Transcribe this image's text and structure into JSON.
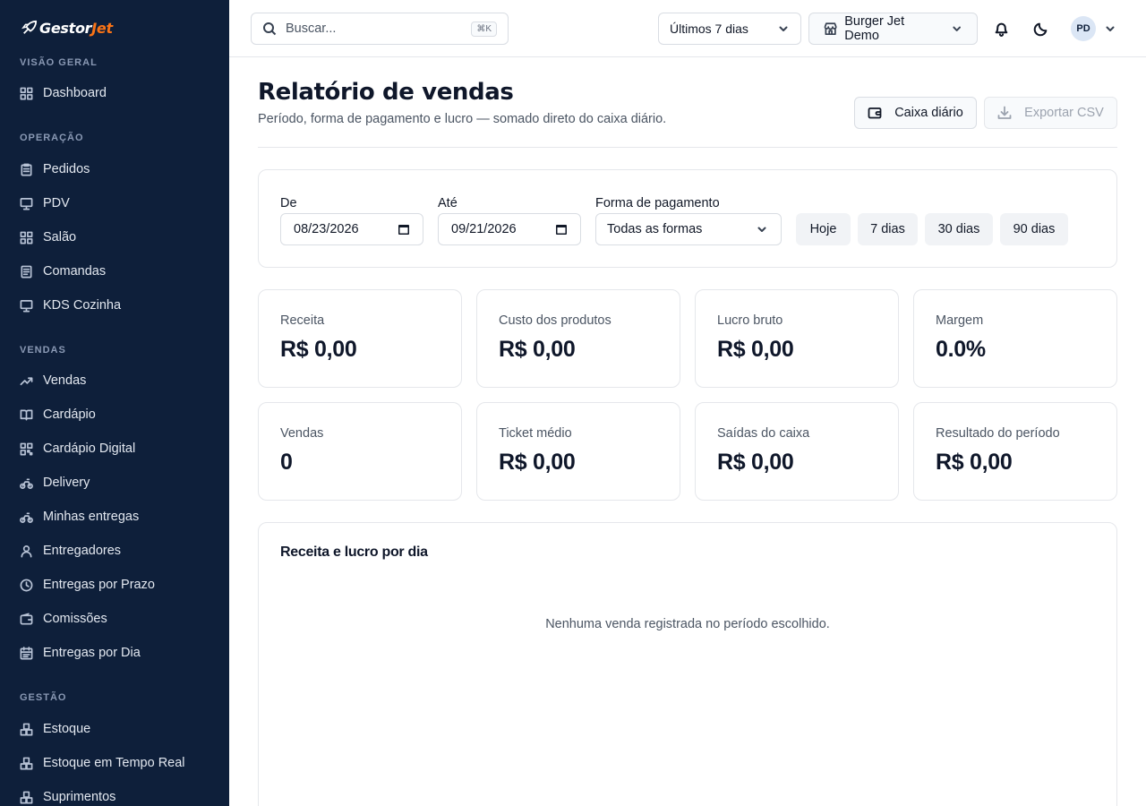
{
  "brand": {
    "name_main": "Gestor",
    "name_accent": "Jet"
  },
  "sidebar": {
    "sections": [
      {
        "label": "VISÃO GERAL"
      },
      {
        "label": "OPERAÇÃO"
      },
      {
        "label": "VENDAS"
      },
      {
        "label": "GESTÃO"
      }
    ],
    "items": [
      {
        "label": "Dashboard",
        "icon": "grid-icon"
      },
      {
        "label": "Pedidos",
        "icon": "clipboard-icon"
      },
      {
        "label": "PDV",
        "icon": "monitor-icon"
      },
      {
        "label": "Salão",
        "icon": "grid-icon"
      },
      {
        "label": "Comandas",
        "icon": "list-icon"
      },
      {
        "label": "KDS Cozinha",
        "icon": "monitor-icon"
      },
      {
        "label": "Vendas",
        "icon": "trend-up-icon"
      },
      {
        "label": "Cardápio",
        "icon": "book-icon"
      },
      {
        "label": "Cardápio Digital",
        "icon": "qrcode-icon"
      },
      {
        "label": "Delivery",
        "icon": "bike-icon"
      },
      {
        "label": "Minhas entregas",
        "icon": "bike-icon"
      },
      {
        "label": "Entregadores",
        "icon": "user-icon"
      },
      {
        "label": "Entregas por Prazo",
        "icon": "clock-icon"
      },
      {
        "label": "Comissões",
        "icon": "wallet-icon"
      },
      {
        "label": "Entregas por Dia",
        "icon": "calendar-icon"
      },
      {
        "label": "Estoque",
        "icon": "boxes-icon"
      },
      {
        "label": "Estoque em Tempo Real",
        "icon": "boxes-icon"
      },
      {
        "label": "Suprimentos",
        "icon": "boxes-icon"
      }
    ]
  },
  "topbar": {
    "search_placeholder": "Buscar...",
    "search_shortcut": "⌘K",
    "range_value": "Últimos 7 dias",
    "store_value": "Burger Jet Demo",
    "avatar_initials": "PD"
  },
  "page": {
    "title": "Relatório de vendas",
    "subtitle": "Período, forma de pagamento e lucro — somado direto do caixa diário.",
    "caixa_button": "Caixa diário",
    "export_button": "Exportar CSV"
  },
  "filters": {
    "from_label": "De",
    "from_value": "08/23/2026",
    "to_label": "Até",
    "to_value": "09/21/2026",
    "payment_label": "Forma de pagamento",
    "payment_value": "Todas as formas",
    "quick": [
      "Hoje",
      "7 dias",
      "30 dias",
      "90 dias"
    ]
  },
  "stats": [
    {
      "label": "Receita",
      "value": "R$ 0,00"
    },
    {
      "label": "Custo dos produtos",
      "value": "R$ 0,00"
    },
    {
      "label": "Lucro bruto",
      "value": "R$ 0,00"
    },
    {
      "label": "Margem",
      "value": "0.0%"
    },
    {
      "label": "Vendas",
      "value": "0"
    },
    {
      "label": "Ticket médio",
      "value": "R$ 0,00"
    },
    {
      "label": "Saídas do caixa",
      "value": "R$ 0,00"
    },
    {
      "label": "Resultado do período",
      "value": "R$ 0,00"
    }
  ],
  "chart": {
    "title": "Receita e lucro por dia",
    "empty_message": "Nenhuma venda registrada no período escolhido."
  },
  "colors": {
    "sidebar_bg": "#0e1f3a",
    "brand_accent": "#f97316"
  }
}
